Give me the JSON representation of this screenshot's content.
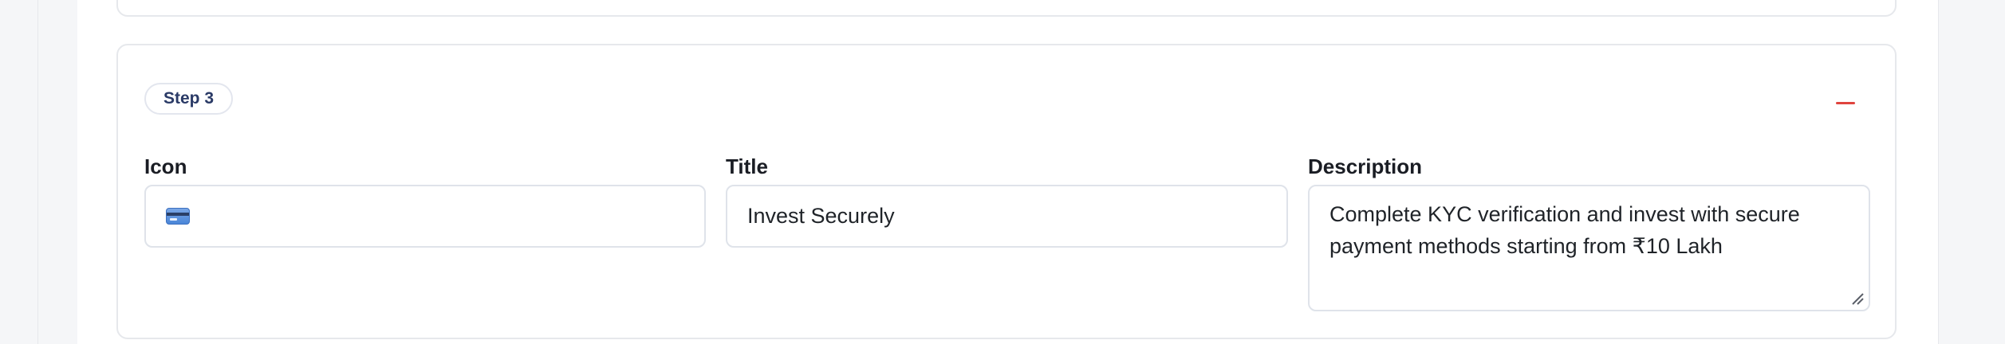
{
  "step": {
    "badge_label": "Step 3"
  },
  "fields": {
    "icon": {
      "label": "Icon",
      "value_icon": "credit-card-icon"
    },
    "title": {
      "label": "Title",
      "value": "Invest Securely"
    },
    "description": {
      "label": "Description",
      "value": "Complete KYC verification and invest with secure payment methods starting from ₹10 Lakh"
    }
  },
  "colors": {
    "remove_accent": "#e0443e",
    "badge_text": "#2a3a66",
    "border": "#dfe3ea"
  }
}
